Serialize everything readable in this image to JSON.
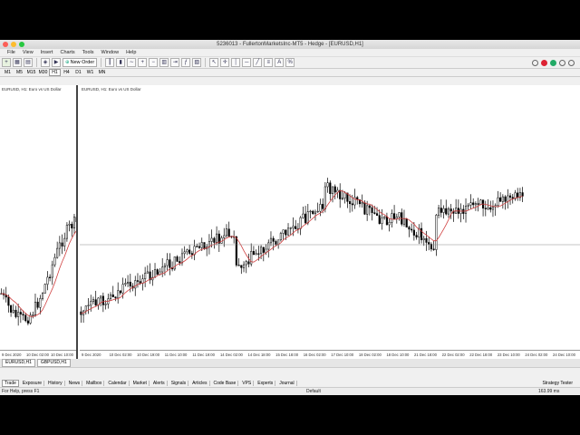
{
  "window": {
    "title": "5236013 - FullertonMarketsInc-MT5 - Hedge - [EURUSD,H1]"
  },
  "menu": [
    "File",
    "View",
    "Insert",
    "Charts",
    "Tools",
    "Window",
    "Help"
  ],
  "toolbar": {
    "new_order_label": "New Order"
  },
  "timeframes": {
    "items": [
      "M1",
      "M5",
      "M15",
      "M30",
      "H1",
      "H4",
      "D1",
      "W1",
      "MN"
    ],
    "active": "H1"
  },
  "charts": {
    "left_label": "EURUSD, H1: Euro vs US Dollar",
    "right_label": "EURUSD, H1: Euro vs US Dollar",
    "left_axis": [
      "9 Dec 2020",
      "10 Dec 02:00",
      "10 Dec 10:00"
    ],
    "right_axis": [
      "9 Dec 2020",
      "10 Dec 02:00",
      "10 Dec 19:00",
      "11 Dec 10:00",
      "11 Dec 19:00",
      "14 Dec 02:00",
      "14 Dec 18:00",
      "15 Dec 18:00",
      "16 Dec 02:00",
      "17 Dec 10:00",
      "18 Dec 02:00",
      "18 Dec 10:00",
      "21 Dec 18:00",
      "22 Dec 02:00",
      "22 Dec 18:00",
      "23 Dec 10:00",
      "24 Dec 02:00",
      "24 Dec 10:00"
    ],
    "colors": {
      "bull": "#000000",
      "ma": "#d04040",
      "crosshair": "#888888"
    }
  },
  "window_tabs": [
    "EURUSD,H1",
    "GBPUSD,H1"
  ],
  "toolbox_tabs": [
    "Trade",
    "Exposure",
    "History",
    "News",
    "Mailbox",
    "Calendar",
    "Market",
    "Alerts",
    "Signals",
    "Articles",
    "Code Base",
    "VPS",
    "Experts",
    "Journal"
  ],
  "toolbox_right": "Strategy Tester",
  "status": {
    "help": "For Help, press F1",
    "profile": "Default",
    "ping": "163.99 ms"
  }
}
